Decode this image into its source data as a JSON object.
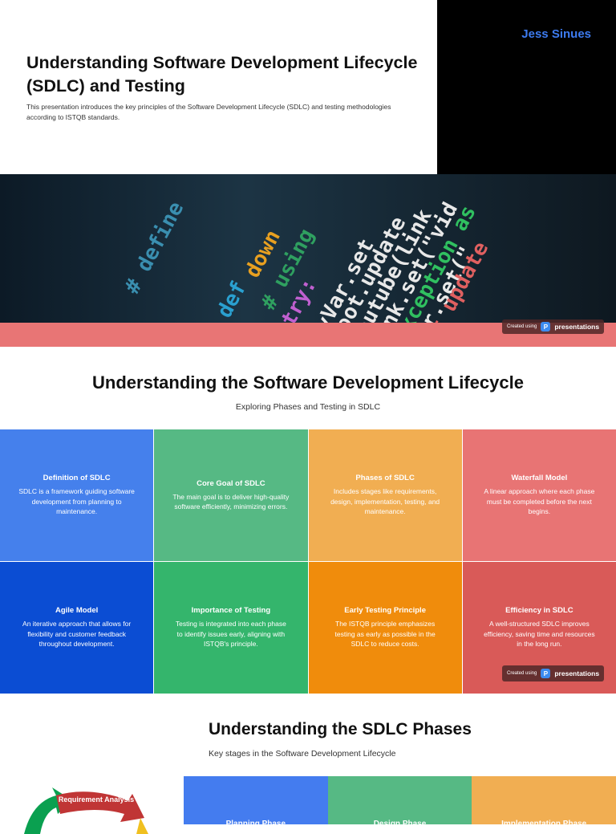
{
  "slide1": {
    "author": "Jess Sinues",
    "title": "Understanding Software Development Lifecycle (SDLC) and Testing",
    "subtitle": "This presentation introduces the key principles of the Software Development Lifecycle (SDLC) and testing methodologies according to ISTQB standards.",
    "code_snippets": [
      "# define",
      "def",
      "down",
      "# using",
      "try:",
      "myVar.set",
      "root.update",
      "youtube(link",
      "link.set(\"vid",
      "Exception as",
      "var.set(\"",
      "t update"
    ]
  },
  "badge": {
    "prefix": "Created using",
    "brand": "presentations",
    "logo": "P"
  },
  "slide2": {
    "title": "Understanding the Software Development Lifecycle",
    "subtitle": "Exploring Phases and Testing in SDLC",
    "cards": [
      {
        "title": "Definition of SDLC",
        "text": "SDLC is a framework guiding software development from planning to maintenance.",
        "color": "#4580ec"
      },
      {
        "title": "Core Goal of SDLC",
        "text": "The main goal is to deliver high-quality software efficiently, minimizing errors.",
        "color": "#56b984"
      },
      {
        "title": "Phases of SDLC",
        "text": "Includes stages like requirements, design, implementation, testing, and maintenance.",
        "color": "#f1ae52"
      },
      {
        "title": "Waterfall Model",
        "text": "A linear approach where each phase must be completed before the next begins.",
        "color": "#e87474"
      },
      {
        "title": "Agile Model",
        "text": "An iterative approach that allows for flexibility and customer feedback throughout development.",
        "color": "#0b4dd3"
      },
      {
        "title": "Importance of Testing",
        "text": "Testing is integrated into each phase to identify issues early, aligning with ISTQB's principle.",
        "color": "#34b56c"
      },
      {
        "title": "Early Testing Principle",
        "text": "The ISTQB principle emphasizes testing as early as possible in the SDLC to reduce costs.",
        "color": "#f08c0c"
      },
      {
        "title": "Efficiency in SDLC",
        "text": "A well-structured SDLC improves efficiency, saving time and resources in the long run.",
        "color": "#d95a58"
      }
    ]
  },
  "slide3": {
    "title": "Understanding the SDLC Phases",
    "subtitle": "Key stages in the Software Development Lifecycle",
    "diagram_label": "Requirement Analysis",
    "phases": [
      {
        "title": "Planning Phase",
        "color": "#447cef"
      },
      {
        "title": "Design Phase",
        "color": "#56b984"
      },
      {
        "title": "Implementation Phase",
        "color": "#f1ae52"
      }
    ]
  }
}
